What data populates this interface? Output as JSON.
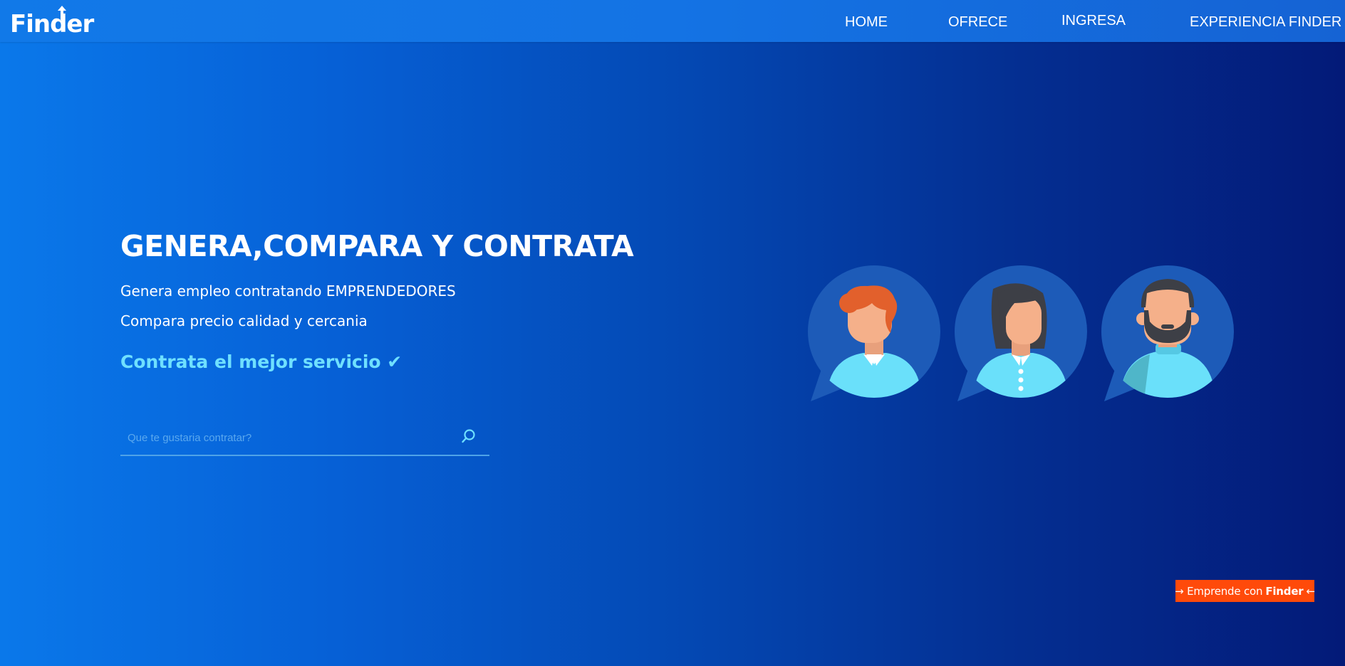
{
  "header": {
    "brand": "Finder",
    "nav": [
      "HOME",
      "OFRECE",
      "INGRESA",
      "EXPERIENCIA FINDER"
    ]
  },
  "hero": {
    "title": "GENERA,COMPARA Y CONTRATA",
    "line1": "Genera empleo contratando EMPRENDEDORES",
    "line2": "Compara precio calidad y cercania",
    "cta": "Contrata el mejor servicio ✔"
  },
  "search": {
    "placeholder": "Que te gustaria contratar?",
    "value": "",
    "icon": "search-icon"
  },
  "illustration": {
    "avatars": [
      "redhead-man-avatar",
      "woman-avatar",
      "bearded-man-avatar"
    ]
  },
  "emprende": {
    "prefix": "→ Emprende con",
    "brand": "Finder",
    "suffix": "←"
  },
  "colors": {
    "accent": "#6fe0ff",
    "button": "#ff4a0a",
    "bubble": "#1d5bb8",
    "shirt": "#6ae0fa",
    "skin": "#f5b08a"
  }
}
